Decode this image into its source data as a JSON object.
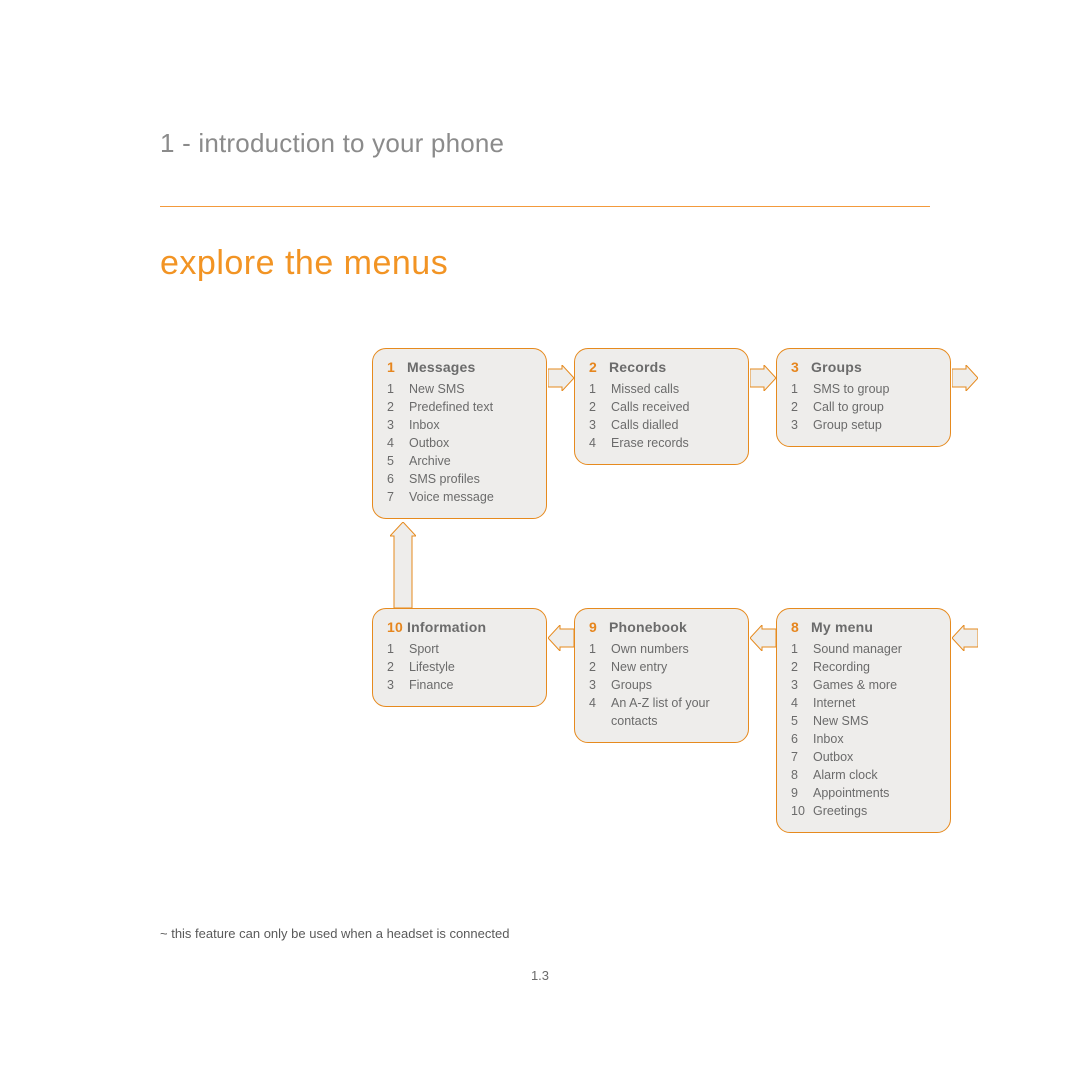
{
  "chapter": "1 - introduction to your phone",
  "section": "explore the menus",
  "boxes": {
    "b1": {
      "num": "1",
      "title": "Messages",
      "items": [
        {
          "n": "1",
          "t": "New SMS"
        },
        {
          "n": "2",
          "t": "Predefined text"
        },
        {
          "n": "3",
          "t": "Inbox"
        },
        {
          "n": "4",
          "t": "Outbox"
        },
        {
          "n": "5",
          "t": "Archive"
        },
        {
          "n": "6",
          "t": "SMS profiles"
        },
        {
          "n": "7",
          "t": "Voice message"
        }
      ]
    },
    "b2": {
      "num": "2",
      "title": "Records",
      "items": [
        {
          "n": "1",
          "t": "Missed calls"
        },
        {
          "n": "2",
          "t": "Calls received"
        },
        {
          "n": "3",
          "t": "Calls dialled"
        },
        {
          "n": "4",
          "t": "Erase records"
        }
      ]
    },
    "b3": {
      "num": "3",
      "title": "Groups",
      "items": [
        {
          "n": "1",
          "t": "SMS to group"
        },
        {
          "n": "2",
          "t": "Call to group"
        },
        {
          "n": "3",
          "t": "Group setup"
        }
      ]
    },
    "b10": {
      "num": "10",
      "title": "Information",
      "items": [
        {
          "n": "1",
          "t": "Sport"
        },
        {
          "n": "2",
          "t": "Lifestyle"
        },
        {
          "n": "3",
          "t": "Finance"
        }
      ]
    },
    "b9": {
      "num": "9",
      "title": "Phonebook",
      "items": [
        {
          "n": "1",
          "t": "Own numbers"
        },
        {
          "n": "2",
          "t": "New entry"
        },
        {
          "n": "3",
          "t": "Groups"
        },
        {
          "n": "4",
          "t": "An A-Z list of your contacts"
        }
      ]
    },
    "b8": {
      "num": "8",
      "title": "My menu",
      "items": [
        {
          "n": "1",
          "t": "Sound manager"
        },
        {
          "n": "2",
          "t": "Recording"
        },
        {
          "n": "3",
          "t": "Games & more"
        },
        {
          "n": "4",
          "t": "Internet"
        },
        {
          "n": "5",
          "t": "New SMS"
        },
        {
          "n": "6",
          "t": "Inbox"
        },
        {
          "n": "7",
          "t": "Outbox"
        },
        {
          "n": "8",
          "t": "Alarm clock"
        },
        {
          "n": "9",
          "t": "Appointments"
        },
        {
          "n": "10",
          "t": "Greetings"
        }
      ]
    }
  },
  "footnote": "~ this feature can only be used when a headset is connected",
  "pagenum": "1.3"
}
